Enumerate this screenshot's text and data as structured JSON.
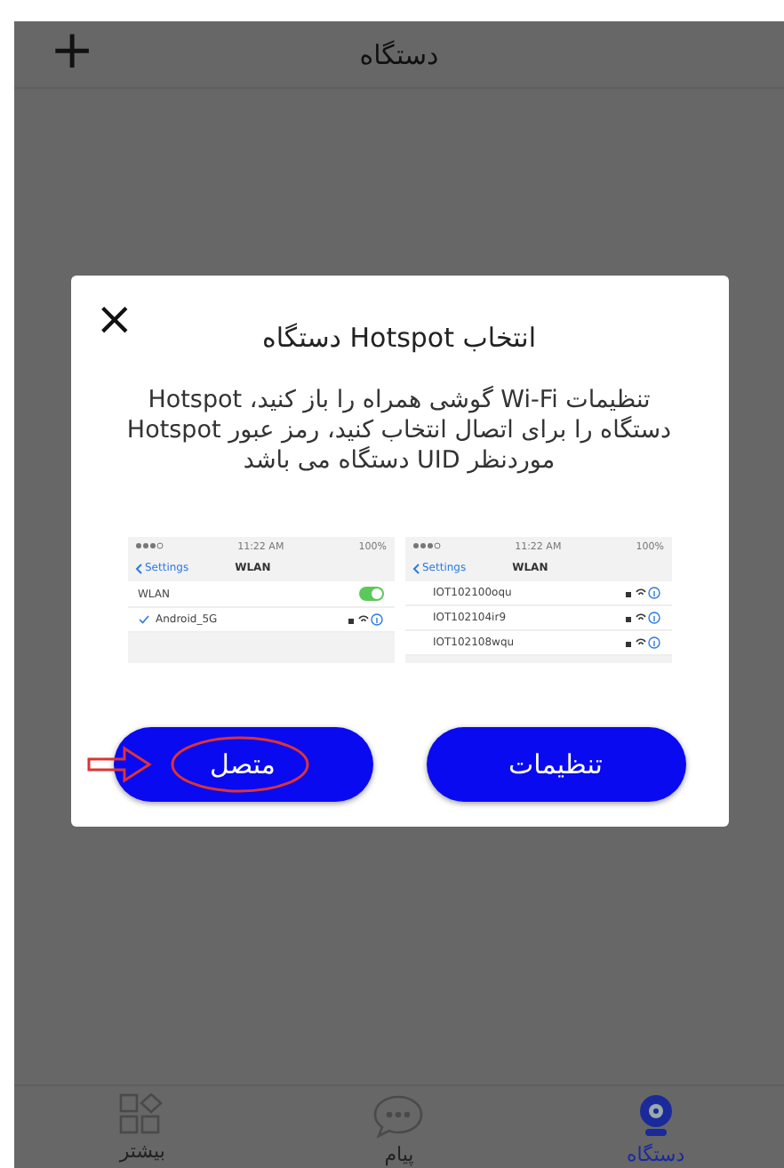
{
  "header": {
    "title": "دستگاه",
    "add_icon": "+"
  },
  "dialog": {
    "close": "×",
    "title": "انتخاب Hotspot دستگاه",
    "message": "تنظیمات Wi-Fi گوشی همراه را باز کنید، Hotspot دستگاه را برای اتصال انتخاب کنید، رمز عبور Hotspot موردنظر UID دستگاه می باشد",
    "guide_screens": [
      {
        "status_time": "11:22 AM",
        "status_battery": "100%",
        "back": "Settings",
        "title": "WLAN",
        "networks": [
          {
            "name": "IOT102100oqu",
            "checked": false
          },
          {
            "name": "IOT102104ir9",
            "checked": false
          },
          {
            "name": "IOT102108wqu",
            "checked": false
          }
        ]
      },
      {
        "status_time": "11:22 AM",
        "status_battery": "100%",
        "back": "Settings",
        "title": "WLAN",
        "toggle": {
          "label": "WLAN",
          "on": true
        },
        "networks": [
          {
            "name": "Android_5G",
            "checked": true
          }
        ]
      }
    ],
    "buttons": [
      {
        "label": "تنظیمات",
        "highlighted": false
      },
      {
        "label": "متصل",
        "highlighted": true
      }
    ]
  },
  "tabs": [
    {
      "label": "دستگاه",
      "kind": "device",
      "selected": true
    },
    {
      "label": "پیام",
      "kind": "message",
      "selected": false
    },
    {
      "label": "بیشتر",
      "kind": "more",
      "selected": false
    }
  ]
}
